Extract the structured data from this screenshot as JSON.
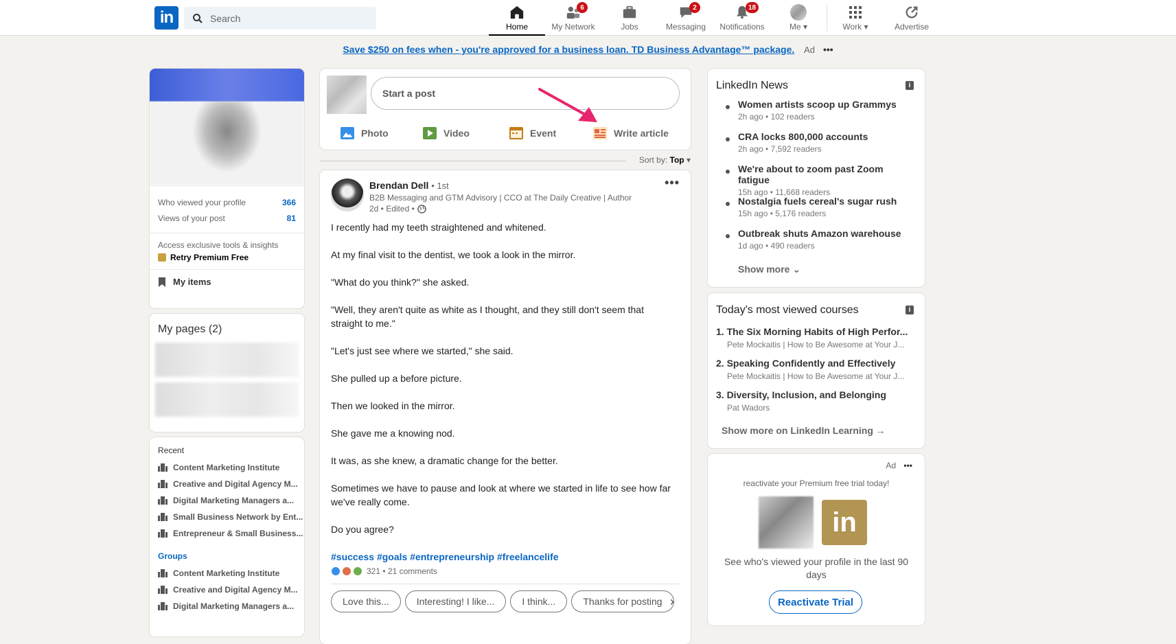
{
  "nav": {
    "logo": "in",
    "search_placeholder": "Search",
    "items": [
      {
        "label": "Home",
        "icon": "home-icon",
        "active": true,
        "badge": null
      },
      {
        "label": "My Network",
        "icon": "network-icon",
        "active": false,
        "badge": "6"
      },
      {
        "label": "Jobs",
        "icon": "briefcase-icon",
        "active": false,
        "badge": null
      },
      {
        "label": "Messaging",
        "icon": "messaging-icon",
        "active": false,
        "badge": "2"
      },
      {
        "label": "Notifications",
        "icon": "bell-icon",
        "active": false,
        "badge": "18"
      },
      {
        "label": "Me",
        "icon": "avatar",
        "active": false,
        "badge": null
      },
      {
        "label": "Work",
        "icon": "grid-icon",
        "active": false,
        "badge": null
      },
      {
        "label": "Advertise",
        "icon": "advertise-icon",
        "active": false,
        "badge": null
      }
    ]
  },
  "ad_banner": {
    "link": "Save $250 on fees when",
    "text": " - you're approved for a business loan. TD Business Advantage™ package.",
    "ad_label": "Ad",
    "more": "•••"
  },
  "profile": {
    "stats": [
      {
        "label": "Who viewed your profile",
        "value": "366"
      },
      {
        "label": "Views of your post",
        "value": "81"
      }
    ],
    "premium_text": "Access exclusive tools & insights",
    "premium_link": "Retry Premium Free",
    "my_items": "My items"
  },
  "pages": {
    "title": "My pages (2)"
  },
  "recent": {
    "recent_label": "Recent",
    "recent_items": [
      "Content Marketing Institute",
      "Creative and Digital Agency M...",
      "Digital Marketing Managers a...",
      "Small Business Network by Ent...",
      "Entrepreneur & Small Business..."
    ],
    "groups_label": "Groups",
    "group_items": [
      "Content Marketing Institute",
      "Creative and Digital Agency M...",
      "Digital Marketing Managers a..."
    ]
  },
  "share": {
    "placeholder": "Start a post",
    "actions": [
      {
        "label": "Photo",
        "color": "#378fe9"
      },
      {
        "label": "Video",
        "color": "#5f9b41"
      },
      {
        "label": "Event",
        "color": "#c37d16"
      },
      {
        "label": "Write article",
        "color": "#e16745"
      }
    ]
  },
  "sort": {
    "label": "Sort by:",
    "value": "Top"
  },
  "post": {
    "author": "Brendan Dell",
    "degree": "• 1st",
    "headline": "B2B Messaging and GTM Advisory | CCO at The Daily Creative | Author",
    "time": "2d • Edited •",
    "menu": "•••",
    "paragraphs": [
      "I recently had my teeth straightened and whitened.",
      "At my final visit to the dentist, we took a look in the mirror.",
      "\"What do you think?\" she asked.",
      "\"Well, they aren't quite as white as I thought, and they still don't seem that straight to me.\"",
      "\"Let's just see where we started,\" she said.",
      "She pulled up a before picture.",
      "Then we looked in the mirror.",
      "She gave me a knowing nod.",
      "It was, as she knew, a dramatic change for the better.",
      "Sometimes we have to pause and look at where we started in life to see how far we've really come.",
      "Do you agree?"
    ],
    "hashtags": "#success #goals #entrepreneurship #freelancelife",
    "reactions": "321 • 21 comments",
    "quick_replies": [
      "Love this...",
      "Interesting! I like...",
      "I think...",
      "Thanks for posting"
    ]
  },
  "news": {
    "title": "LinkedIn News",
    "items": [
      {
        "title": "Women artists scoop up Grammys",
        "meta": "2h ago • 102 readers"
      },
      {
        "title": "CRA locks 800,000 accounts",
        "meta": "2h ago • 7,592 readers"
      },
      {
        "title": "We're about to zoom past Zoom fatigue",
        "meta": "15h ago • 11,668 readers"
      },
      {
        "title": "Nostalgia fuels cereal's sugar rush",
        "meta": "15h ago • 5,176 readers"
      },
      {
        "title": "Outbreak shuts Amazon warehouse",
        "meta": "1d ago • 490 readers"
      }
    ],
    "show_more": "Show more"
  },
  "courses": {
    "title": "Today's most viewed courses",
    "items": [
      {
        "title": "1. The Six Morning Habits of High Perfor...",
        "meta": "Pete Mockaitis | How to Be Awesome at Your J..."
      },
      {
        "title": "2. Speaking Confidently and Effectively",
        "meta": "Pete Mockaitis | How to Be Awesome at Your J..."
      },
      {
        "title": "3. Diversity, Inclusion, and Belonging",
        "meta": "Pat Wadors"
      }
    ],
    "link": "Show more on LinkedIn Learning →"
  },
  "side_ad": {
    "ad_label": "Ad",
    "more": "•••",
    "tagline": "reactivate your Premium free trial today!",
    "logo": "in",
    "text": "See who's viewed your profile in the last 90 days",
    "button": "Reactivate Trial"
  }
}
